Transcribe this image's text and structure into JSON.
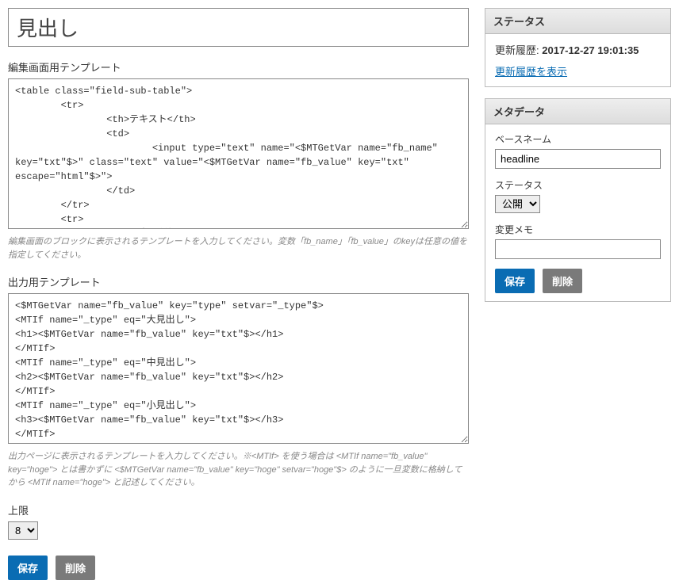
{
  "main": {
    "title_value": "見出し",
    "editTemplate": {
      "label": "編集画面用テンプレート",
      "value": "<table class=\"field-sub-table\">\n        <tr>\n                <th>テキスト</th>\n                <td>\n                        <input type=\"text\" name=\"<$MTGetVar name=\"fb_name\" key=\"txt\"$>\" class=\"text\" value=\"<$MTGetVar name=\"fb_value\" key=\"txt\" escape=\"html\"$>\">\n                </td>\n        </tr>\n        <tr>\n                <th>見出し種類</th>",
      "hint": "編集画面のブロックに表示されるテンプレートを入力してください。変数「fb_name」「fb_value」のkeyは任意の値を指定してください。"
    },
    "outputTemplate": {
      "label": "出力用テンプレート",
      "value": "<$MTGetVar name=\"fb_value\" key=\"type\" setvar=\"_type\"$>\n<MTIf name=\"_type\" eq=\"大見出し\">\n<h1><$MTGetVar name=\"fb_value\" key=\"txt\"$></h1>\n</MTIf>\n<MTIf name=\"_type\" eq=\"中見出し\">\n<h2><$MTGetVar name=\"fb_value\" key=\"txt\"$></h2>\n</MTIf>\n<MTIf name=\"_type\" eq=\"小見出し\">\n<h3><$MTGetVar name=\"fb_value\" key=\"txt\"$></h3>\n</MTIf>",
      "hint": "出力ページに表示されるテンプレートを入力してください。※<MTIf> を使う場合は <MTIf name=\"fb_value\" key=\"hoge\"> とは書かずに <$MTGetVar name=\"fb_value\" key=\"hoge\" setvar=\"hoge\"$> のように一旦変数に格納してから <MTIf name=\"hoge\"> と記述してください。"
    },
    "limit": {
      "label": "上限",
      "value": "8"
    },
    "buttons": {
      "save": "保存",
      "delete": "削除"
    }
  },
  "sidebar": {
    "status": {
      "title": "ステータス",
      "history_label": "更新履歴:",
      "history_value": "2017-12-27 19:01:35",
      "history_link": "更新履歴を表示"
    },
    "metadata": {
      "title": "メタデータ",
      "basename": {
        "label": "ベースネーム",
        "value": "headline"
      },
      "status": {
        "label": "ステータス",
        "value": "公開"
      },
      "memo": {
        "label": "変更メモ",
        "value": ""
      },
      "buttons": {
        "save": "保存",
        "delete": "削除"
      }
    }
  }
}
